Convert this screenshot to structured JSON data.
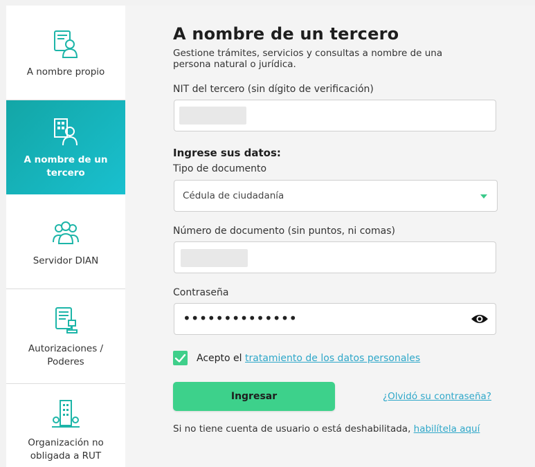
{
  "sidebar": {
    "items": [
      {
        "label": "A nombre propio",
        "icon": "person-document-icon"
      },
      {
        "label": "A nombre de un tercero",
        "icon": "person-building-icon",
        "active": true
      },
      {
        "label": "Servidor DIAN",
        "icon": "group-people-icon"
      },
      {
        "label": "Autorizaciones / Poderes",
        "icon": "document-stamp-icon"
      },
      {
        "label": "Organización no obligada a RUT",
        "icon": "building-icon"
      }
    ]
  },
  "main": {
    "title": "A nombre de un tercero",
    "subtitle": "Gestione trámites, servicios y consultas a nombre de una persona natural o jurídica.",
    "nit_label": "NIT del tercero (sin dígito de verificación)",
    "nit_value": "",
    "section_heading": "Ingrese sus datos:",
    "doc_type_label": "Tipo de documento",
    "doc_type_value": "Cédula de ciudadanía",
    "doc_number_label": "Número de documento (sin puntos, ni comas)",
    "doc_number_value": "",
    "password_label": "Contraseña",
    "password_mask": "••••••••••••••",
    "terms_prefix": "Acepto el ",
    "terms_link": "tratamiento de los datos personales",
    "terms_checked": true,
    "submit_label": "Ingresar",
    "forgot_link": "¿Olvidó su contraseña?",
    "footer_text": "Si no tiene cuenta de usuario o está deshabilitada, ",
    "footer_link": "habilítela aquí"
  },
  "colors": {
    "accent_gradient_start": "#13a6a6",
    "accent_gradient_end": "#19c0cf",
    "button_green": "#3dd18b",
    "link_blue": "#2ea7c9",
    "icon_teal": "#1cb5a8"
  }
}
